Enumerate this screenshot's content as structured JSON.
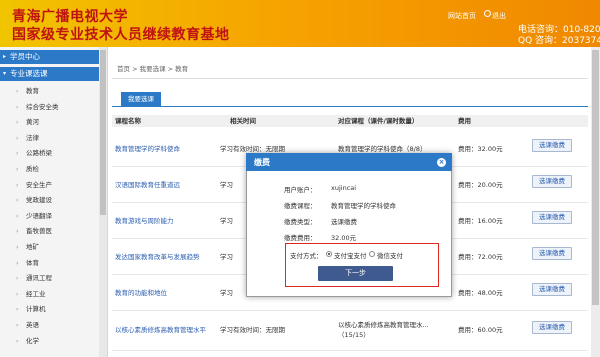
{
  "header": {
    "title_line1": "青海广播电视大学",
    "title_line2": "国家级专业技术人员继续教育基地",
    "nav_home": "网站首页",
    "nav_exit": "退出",
    "contact_phone": "电话咨询：010-8203",
    "contact_qq": "QQ 咨询：20373749"
  },
  "sidebar": {
    "head_center": "学员中心",
    "head_select": "专业课选课",
    "items": [
      "教育",
      "综合安全类",
      "黄河",
      "法律",
      "公路桥梁",
      "质检",
      "安全生产",
      "党政建设",
      "少语翻译",
      "畜牧兽医",
      "地矿",
      "体育",
      "通讯工程",
      "经工业",
      "计算机",
      "英语",
      "化学"
    ]
  },
  "main": {
    "breadcrumb": "首页 > 我要选课 > 教育",
    "tab_label": "我要选课",
    "headers": {
      "name": "课程名称",
      "time": "相关时间",
      "course": "对应课程（课件/课时数量）",
      "fee": "费用"
    },
    "rows": [
      {
        "name": "教育管理学的学科使命",
        "time": "学习有效时间：无限期",
        "course": "教育管理学的学科使命（8/8）",
        "fee": "费用：32.00元",
        "button": "选课缴费"
      },
      {
        "name": "汉语国际教育任重道远",
        "time": "学习",
        "course": "",
        "fee": "费用：20.00元",
        "button": "选课缴费"
      },
      {
        "name": "教育游戏与周阶能力",
        "time": "学习",
        "course": "",
        "fee": "费用：16.00元",
        "button": "选课缴费"
      },
      {
        "name": "发达国家教育改革与发展趋势",
        "time": "学习",
        "course": "",
        "fee": "费用：72.00元",
        "button": "选课缴费"
      },
      {
        "name": "教育的功能和地位",
        "time": "学习",
        "course": "",
        "fee": "费用：48.00元",
        "button": "选课缴费"
      },
      {
        "name": "以核心素质修炼高教育管理水平",
        "time": "学习有效时间：无限期",
        "course": "以核心素质修炼高教育管理水...（15/15）",
        "fee": "费用：60.00元",
        "button": "选课缴费"
      }
    ]
  },
  "modal": {
    "title": "缴费",
    "close": "×",
    "labels": {
      "user": "用户账户：",
      "course": "缴费课程：",
      "type": "缴费类型：",
      "amount": "缴费费用："
    },
    "values": {
      "user": "xujincai",
      "course": "教育管理学的学科使命",
      "type": "选课缴费",
      "amount": "32.00元"
    },
    "pay_label": "支付方式：",
    "pay_alipay": "支付宝支付",
    "pay_wechat": "微信支付",
    "next_button": "下一步"
  },
  "colors": {
    "header_start": "#f1c400",
    "header_end": "#f08800",
    "title_red": "#c01212",
    "blue": "#2c79c8",
    "button_dark": "#3f5a8f",
    "highlight_red": "#e0271f"
  }
}
